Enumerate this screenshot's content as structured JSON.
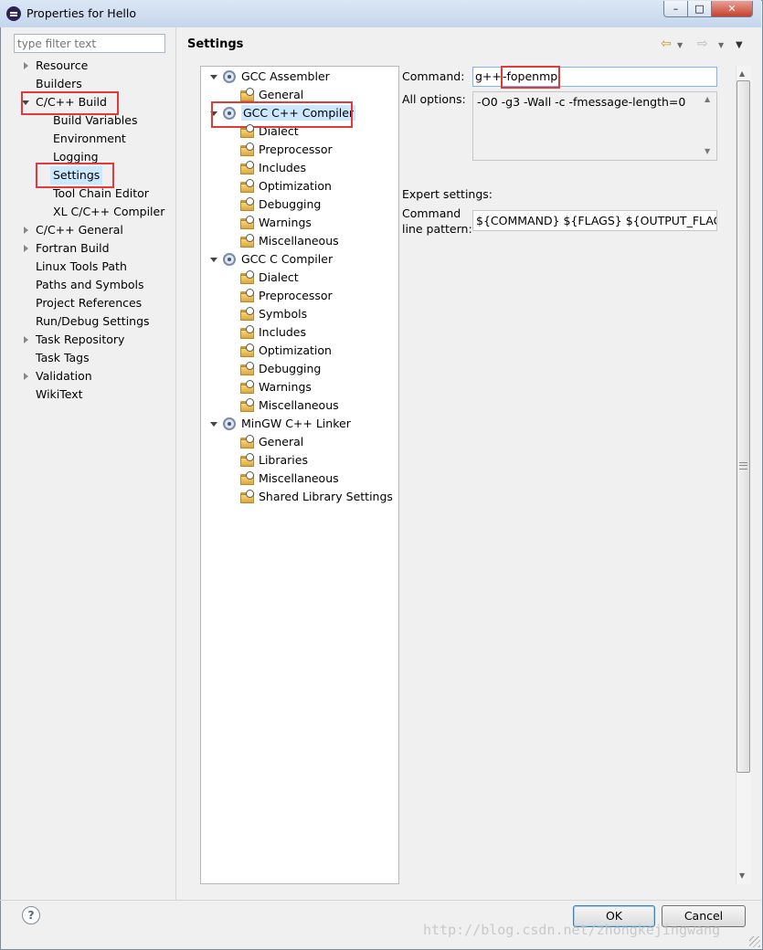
{
  "window": {
    "title": "Properties for Hello",
    "min_label": "–",
    "max_label": "□",
    "close_label": "✕"
  },
  "filter": {
    "placeholder": "type filter text"
  },
  "nav": {
    "items": [
      {
        "label": "Resource",
        "expander": "collapsed"
      },
      {
        "label": "Builders",
        "expander": "none"
      },
      {
        "label": "C/C++ Build",
        "expander": "expanded"
      },
      {
        "label": "Build Variables",
        "expander": "none"
      },
      {
        "label": "Environment",
        "expander": "none"
      },
      {
        "label": "Logging",
        "expander": "none"
      },
      {
        "label": "Settings",
        "expander": "none",
        "selected": true
      },
      {
        "label": "Tool Chain Editor",
        "expander": "none"
      },
      {
        "label": "XL C/C++ Compiler",
        "expander": "none"
      },
      {
        "label": "C/C++ General",
        "expander": "collapsed"
      },
      {
        "label": "Fortran Build",
        "expander": "collapsed"
      },
      {
        "label": "Linux Tools Path",
        "expander": "none"
      },
      {
        "label": "Paths and Symbols",
        "expander": "none"
      },
      {
        "label": "Project References",
        "expander": "none"
      },
      {
        "label": "Run/Debug Settings",
        "expander": "none"
      },
      {
        "label": "Task Repository",
        "expander": "collapsed"
      },
      {
        "label": "Task Tags",
        "expander": "none"
      },
      {
        "label": "Validation",
        "expander": "collapsed"
      },
      {
        "label": "WikiText",
        "expander": "none"
      }
    ]
  },
  "settings": {
    "title": "Settings",
    "back_icon": "back-arrow-icon",
    "forward_icon": "forward-arrow-icon",
    "menu_icon": "view-menu-icon"
  },
  "tool_tree": {
    "items": [
      {
        "label": "GCC Assembler",
        "kind": "tool"
      },
      {
        "label": "General",
        "kind": "option"
      },
      {
        "label": "GCC C++ Compiler",
        "kind": "tool",
        "selected": true
      },
      {
        "label": "Dialect",
        "kind": "option"
      },
      {
        "label": "Preprocessor",
        "kind": "option"
      },
      {
        "label": "Includes",
        "kind": "option"
      },
      {
        "label": "Optimization",
        "kind": "option"
      },
      {
        "label": "Debugging",
        "kind": "option"
      },
      {
        "label": "Warnings",
        "kind": "option"
      },
      {
        "label": "Miscellaneous",
        "kind": "option"
      },
      {
        "label": "GCC C Compiler",
        "kind": "tool"
      },
      {
        "label": "Dialect",
        "kind": "option"
      },
      {
        "label": "Preprocessor",
        "kind": "option"
      },
      {
        "label": "Symbols",
        "kind": "option"
      },
      {
        "label": "Includes",
        "kind": "option"
      },
      {
        "label": "Optimization",
        "kind": "option"
      },
      {
        "label": "Debugging",
        "kind": "option"
      },
      {
        "label": "Warnings",
        "kind": "option"
      },
      {
        "label": "Miscellaneous",
        "kind": "option"
      },
      {
        "label": "MinGW C++ Linker",
        "kind": "tool"
      },
      {
        "label": "General",
        "kind": "option"
      },
      {
        "label": "Libraries",
        "kind": "option"
      },
      {
        "label": "Miscellaneous",
        "kind": "option"
      },
      {
        "label": "Shared Library Settings",
        "kind": "option"
      }
    ]
  },
  "content": {
    "command_label": "Command:",
    "command_value": "g++",
    "command_flag": "-fopenmp",
    "all_options_label": "All options:",
    "all_options_value": "-O0 -g3 -Wall -c -fmessage-length=0",
    "expert_label": "Expert settings:",
    "cmd_pattern_label_1": "Command",
    "cmd_pattern_label_2": "line pattern:",
    "cmd_pattern_value": "${COMMAND} ${FLAGS} ${OUTPUT_FLAG} ${OUTPUT_PREFIX}${OUTPUT} ${INPUTS}"
  },
  "footer": {
    "help_label": "?",
    "ok_label": "OK",
    "cancel_label": "Cancel",
    "watermark": "http://blog.csdn.net/zhongkejingwang"
  },
  "colors": {
    "highlight": "#e03a3a",
    "selection": "#cce8ff"
  }
}
